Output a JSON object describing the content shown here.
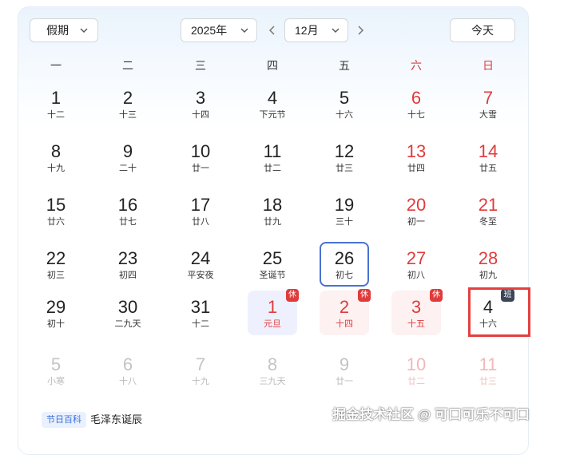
{
  "toolbar": {
    "holiday_select": "假期",
    "year_select": "2025年",
    "month_select": "12月",
    "today_button": "今天"
  },
  "weekdays": [
    {
      "label": "一",
      "weekend": false
    },
    {
      "label": "二",
      "weekend": false
    },
    {
      "label": "三",
      "weekend": false
    },
    {
      "label": "四",
      "weekend": false
    },
    {
      "label": "五",
      "weekend": false
    },
    {
      "label": "六",
      "weekend": true
    },
    {
      "label": "日",
      "weekend": true
    }
  ],
  "days": [
    {
      "num": "1",
      "lunar": "十二"
    },
    {
      "num": "2",
      "lunar": "十三"
    },
    {
      "num": "3",
      "lunar": "十四"
    },
    {
      "num": "4",
      "lunar": "下元节"
    },
    {
      "num": "5",
      "lunar": "十六"
    },
    {
      "num": "6",
      "lunar": "十七",
      "weekend": true
    },
    {
      "num": "7",
      "lunar": "大雪",
      "weekend": true
    },
    {
      "num": "8",
      "lunar": "十九"
    },
    {
      "num": "9",
      "lunar": "二十"
    },
    {
      "num": "10",
      "lunar": "廿一"
    },
    {
      "num": "11",
      "lunar": "廿二"
    },
    {
      "num": "12",
      "lunar": "廿三"
    },
    {
      "num": "13",
      "lunar": "廿四",
      "weekend": true
    },
    {
      "num": "14",
      "lunar": "廿五",
      "weekend": true
    },
    {
      "num": "15",
      "lunar": "廿六"
    },
    {
      "num": "16",
      "lunar": "廿七"
    },
    {
      "num": "17",
      "lunar": "廿八"
    },
    {
      "num": "18",
      "lunar": "廿九"
    },
    {
      "num": "19",
      "lunar": "三十"
    },
    {
      "num": "20",
      "lunar": "初一",
      "weekend": true
    },
    {
      "num": "21",
      "lunar": "冬至",
      "weekend": true
    },
    {
      "num": "22",
      "lunar": "初三"
    },
    {
      "num": "23",
      "lunar": "初四"
    },
    {
      "num": "24",
      "lunar": "平安夜"
    },
    {
      "num": "25",
      "lunar": "圣诞节"
    },
    {
      "num": "26",
      "lunar": "初七",
      "selected": true
    },
    {
      "num": "27",
      "lunar": "初八",
      "weekend": true
    },
    {
      "num": "28",
      "lunar": "初九",
      "weekend": true
    },
    {
      "num": "29",
      "lunar": "初十"
    },
    {
      "num": "30",
      "lunar": "二九天"
    },
    {
      "num": "31",
      "lunar": "十二"
    },
    {
      "num": "1",
      "lunar": "元旦",
      "rest": true,
      "badge": "休",
      "tint": "blue"
    },
    {
      "num": "2",
      "lunar": "十四",
      "rest": true,
      "badge": "休"
    },
    {
      "num": "3",
      "lunar": "十五",
      "rest": true,
      "badge": "休"
    },
    {
      "num": "4",
      "lunar": "十六",
      "work": true,
      "badge": "班",
      "highlighted": true
    },
    {
      "num": "5",
      "lunar": "小寒",
      "dim": true
    },
    {
      "num": "6",
      "lunar": "十八",
      "dim": true
    },
    {
      "num": "7",
      "lunar": "十九",
      "dim": true
    },
    {
      "num": "8",
      "lunar": "三九天",
      "dim": true
    },
    {
      "num": "9",
      "lunar": "廿一",
      "dim": true
    },
    {
      "num": "10",
      "lunar": "廿二",
      "dim": true,
      "weekend": true
    },
    {
      "num": "11",
      "lunar": "廿三",
      "dim": true,
      "weekend": true
    }
  ],
  "footer": {
    "tag": "节日百科",
    "text": "毛泽东诞辰"
  },
  "watermark": "掘金技术社区 @ 可口可乐不可口",
  "colors": {
    "weekend_red": "#e03b3b",
    "selected_border": "#4a72d0",
    "highlight_box": "#e2403f",
    "work_badge": "#3c4656"
  }
}
